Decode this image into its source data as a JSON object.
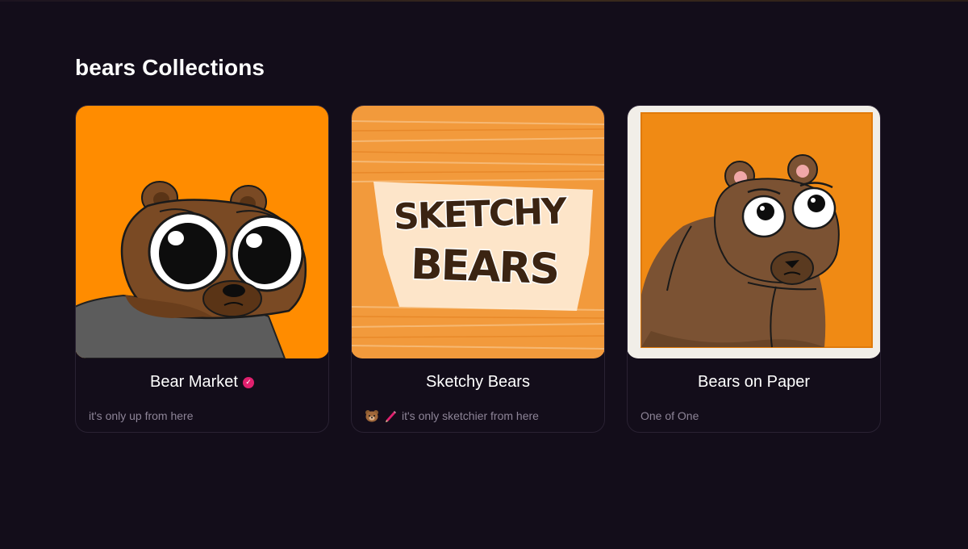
{
  "page": {
    "title": "bears Collections"
  },
  "collections": [
    {
      "name": "Bear Market",
      "verified": true,
      "description": "it's only up from here",
      "art_icon": "big-eyed-bear-art"
    },
    {
      "name": "Sketchy Bears",
      "verified": false,
      "description": "it's only sketchier from here",
      "description_emojis": [
        "bear-face-icon",
        "pencil-icon"
      ],
      "art_icon": "sketchy-bears-logo-art"
    },
    {
      "name": "Bears on Paper",
      "verified": false,
      "description": "One of One",
      "art_icon": "paper-bear-art"
    }
  ],
  "colors": {
    "background": "#130d1a",
    "card_border": "#2a2233",
    "verified_badge": "#e0206e",
    "muted_text": "#8d8497",
    "art_orange": "#ff8c00"
  }
}
